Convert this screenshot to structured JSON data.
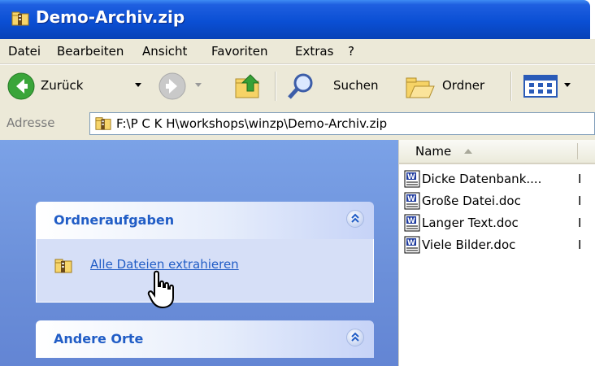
{
  "window": {
    "title": "Demo-Archiv.zip"
  },
  "menu": {
    "items": [
      "Datei",
      "Bearbeiten",
      "Ansicht",
      "Favoriten",
      "Extras",
      "?"
    ]
  },
  "toolbar": {
    "back_label": "Zurück",
    "search_label": "Suchen",
    "folders_label": "Ordner"
  },
  "address": {
    "label": "Adresse",
    "value": "F:\\P C K H\\workshops\\winzp\\Demo-Archiv.zip"
  },
  "taskpane": {
    "folder_tasks": {
      "title": "Ordneraufgaben",
      "link": "Alle Dateien extrahieren"
    },
    "other_places": {
      "title": "Andere Orte"
    }
  },
  "filelist": {
    "column_name": "Name",
    "files": [
      "Dicke Datenbank....",
      "Große Datei.doc",
      "Langer Text.doc",
      "Viele Bilder.doc"
    ],
    "truncated_col": "I"
  },
  "colors": {
    "title_blue": "#0a4fd4",
    "task_link": "#215dc6",
    "pane_blue": "#6b8fd9"
  },
  "icons": {
    "title": "zip-folder-icon",
    "back": "back-arrow-icon",
    "forward": "forward-arrow-icon",
    "up": "folder-up-icon",
    "search": "magnifier-icon",
    "folders": "folders-icon",
    "views": "views-icon",
    "word_doc": "word-doc-icon",
    "cursor": "hand-cursor-icon"
  }
}
